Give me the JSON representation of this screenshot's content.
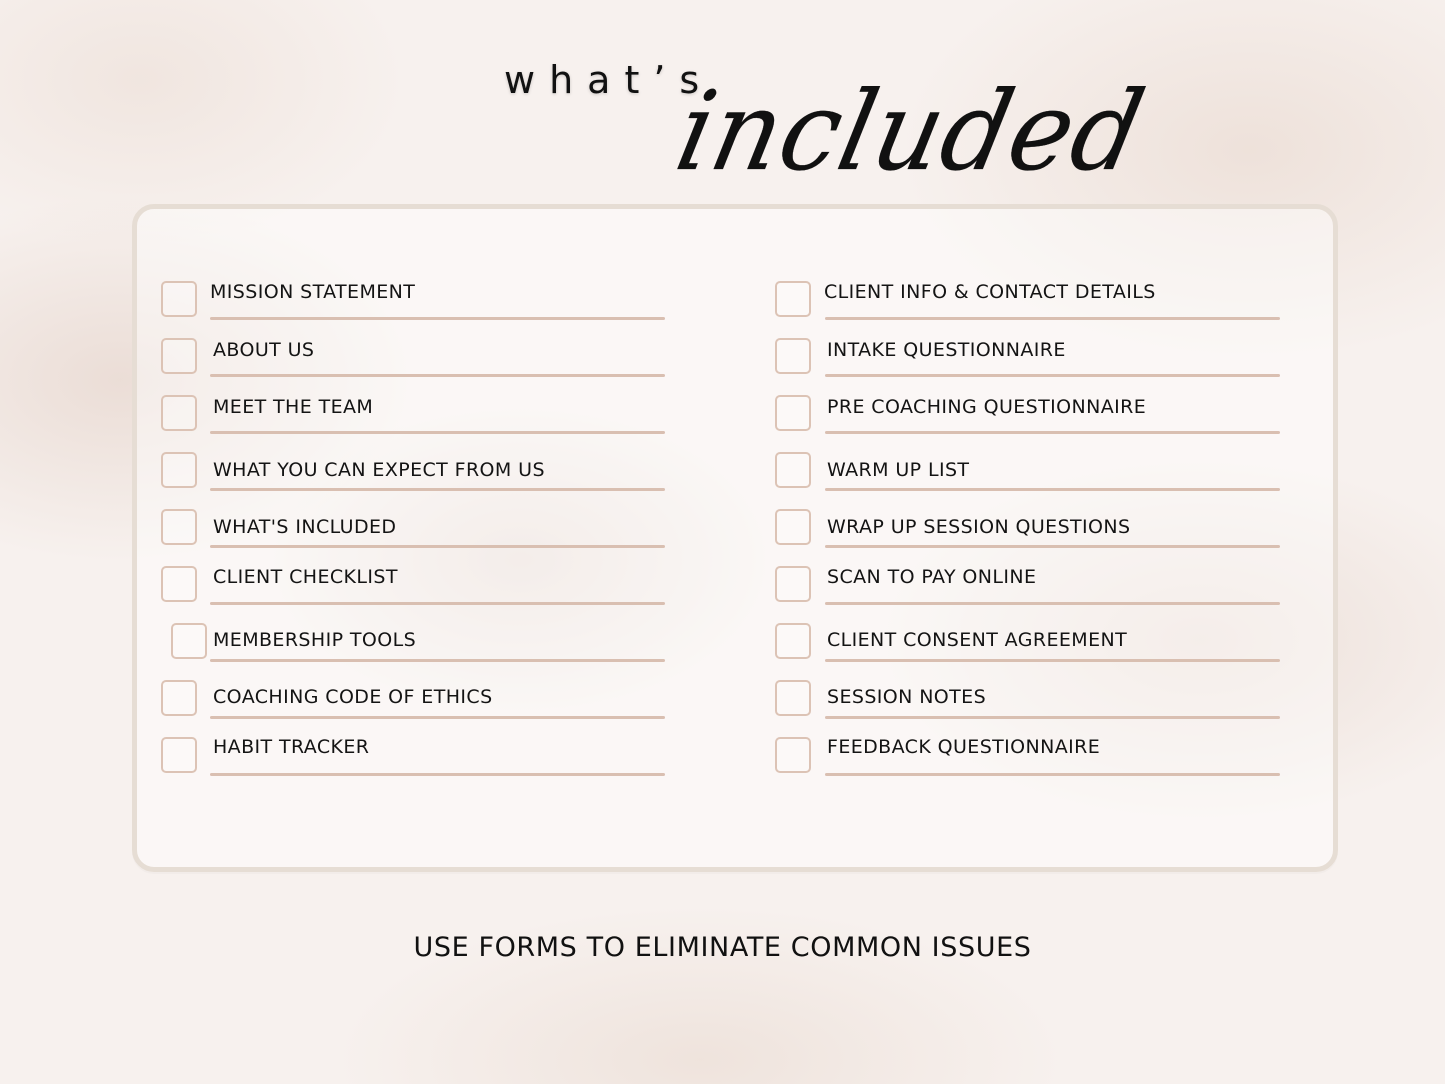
{
  "heading": {
    "line1": "what’s",
    "line2": "included"
  },
  "checklist": {
    "left": [
      {
        "label": "MISSION STATEMENT",
        "checked": false
      },
      {
        "label": "ABOUT US",
        "checked": false
      },
      {
        "label": "MEET THE TEAM",
        "checked": false
      },
      {
        "label": "WHAT YOU CAN EXPECT FROM US",
        "checked": false
      },
      {
        "label": "WHAT'S INCLUDED",
        "checked": false
      },
      {
        "label": "CLIENT CHECKLIST",
        "checked": false
      },
      {
        "label": "MEMBERSHIP TOOLS",
        "checked": false
      },
      {
        "label": "COACHING CODE OF ETHICS",
        "checked": false
      },
      {
        "label": "HABIT TRACKER",
        "checked": false
      }
    ],
    "right": [
      {
        "label": "CLIENT INFO & CONTACT DETAILS",
        "checked": false
      },
      {
        "label": "INTAKE QUESTIONNAIRE",
        "checked": false
      },
      {
        "label": "PRE COACHING QUESTIONNAIRE",
        "checked": false
      },
      {
        "label": "WARM UP LIST",
        "checked": false
      },
      {
        "label": "WRAP UP SESSION QUESTIONS",
        "checked": false
      },
      {
        "label": "SCAN TO PAY ONLINE",
        "checked": false
      },
      {
        "label": "CLIENT CONSENT AGREEMENT",
        "checked": false
      },
      {
        "label": "SESSION NOTES",
        "checked": false
      },
      {
        "label": "FEEDBACK QUESTIONNAIRE",
        "checked": false
      }
    ]
  },
  "footer": {
    "tagline": "USE FORMS TO ELIMINATE COMMON ISSUES"
  },
  "colors": {
    "checkbox_border": "#dcc3b5",
    "rule": "#d9bfb1",
    "card_border": "#e6ddd4",
    "text": "#141414"
  }
}
